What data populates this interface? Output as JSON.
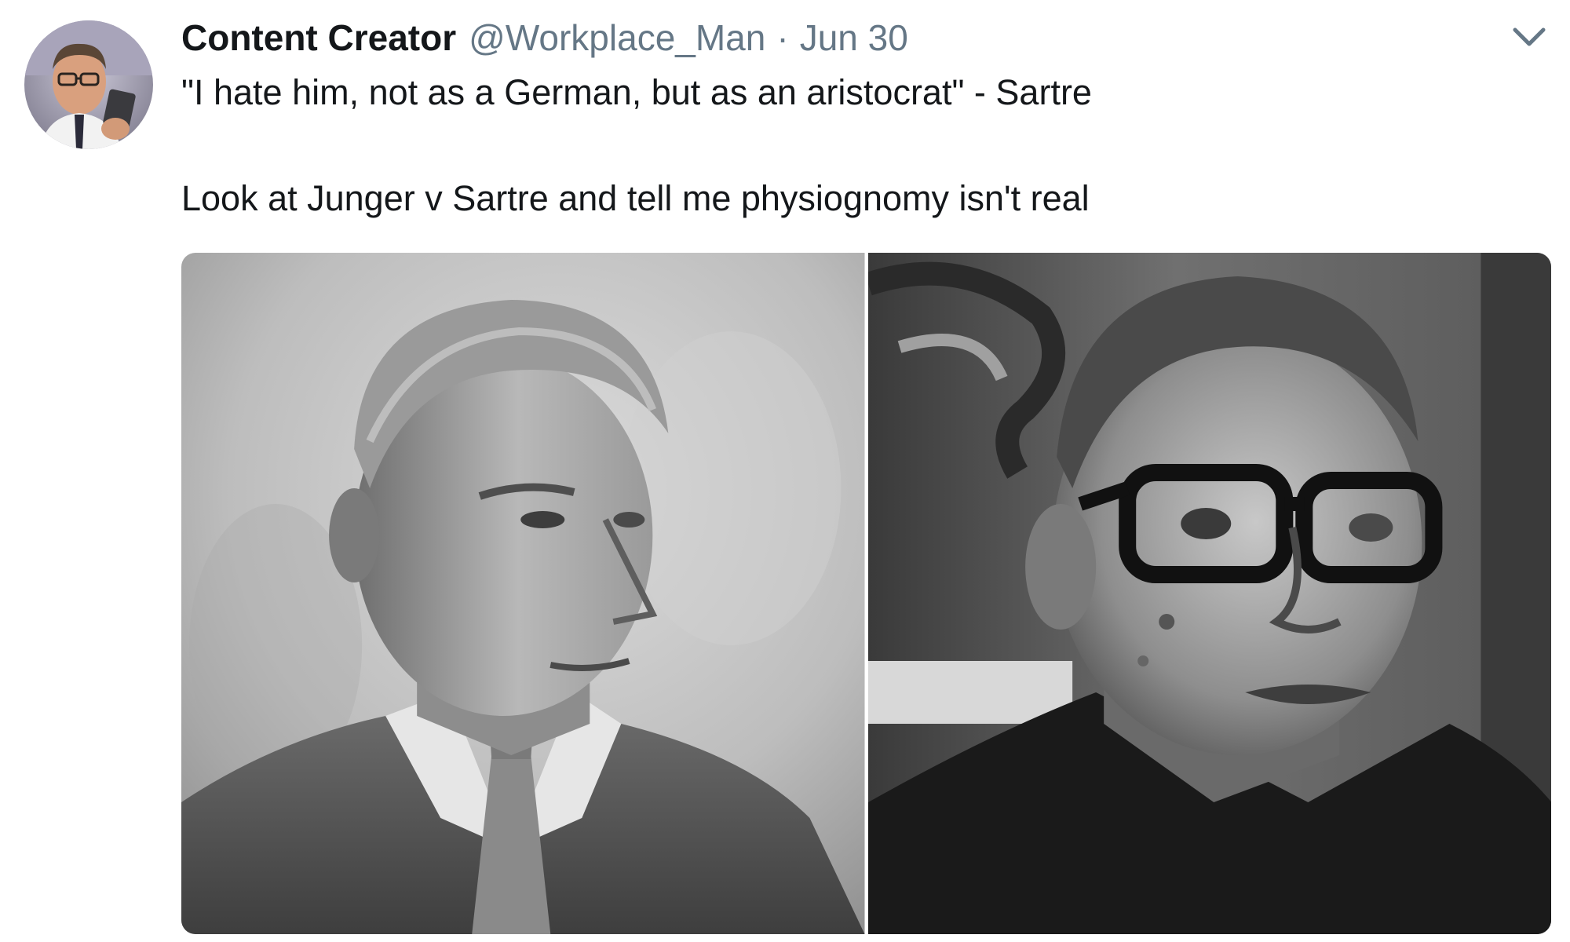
{
  "tweet": {
    "author": {
      "display_name": "Content Creator",
      "handle": "@Workplace_Man",
      "avatar_icon": "user-avatar"
    },
    "separator": "·",
    "timestamp": "Jun 30",
    "menu_icon": "chevron-down-icon",
    "text_lines": [
      "\"I hate him, not as a German, but as an aristocrat\" - Sartre",
      "Look at Junger v Sartre and tell me physiognomy isn't real"
    ],
    "media": [
      {
        "kind": "photo",
        "depicts": "black-and-white portrait, man in suit and tie"
      },
      {
        "kind": "photo",
        "depicts": "black-and-white portrait, man with thick-rimmed glasses"
      }
    ]
  },
  "colors": {
    "text_primary": "#14171a",
    "text_secondary": "#657786",
    "background": "#ffffff"
  }
}
